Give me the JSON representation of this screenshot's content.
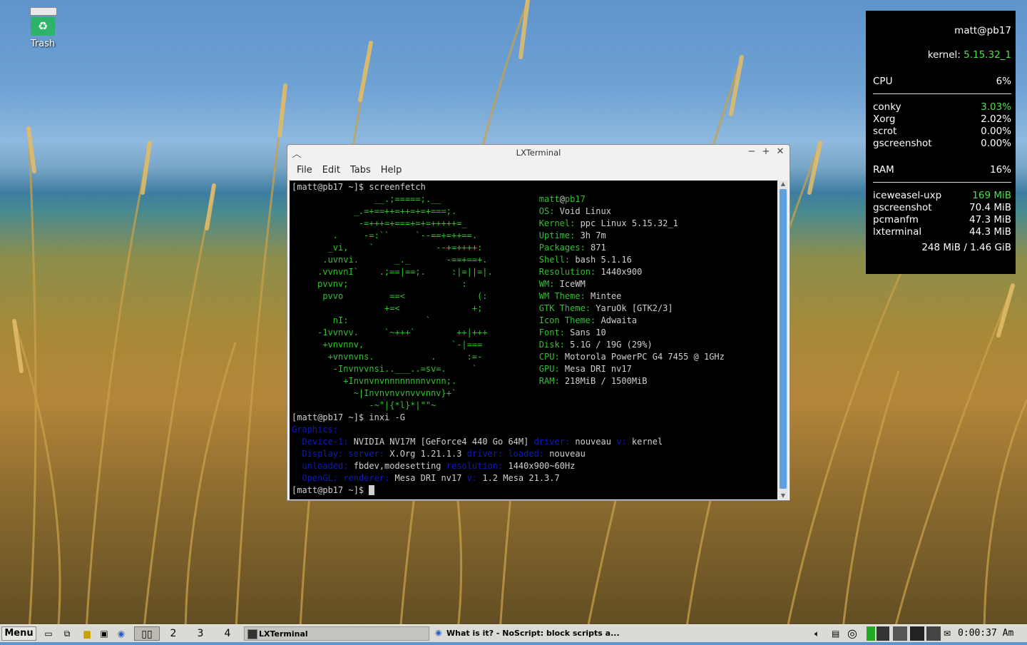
{
  "desktop": {
    "trash_label": "Trash"
  },
  "conky": {
    "user_host": "matt@pb17",
    "kernel_label": "kernel:",
    "kernel_value": "5.15.32_1",
    "cpu_label": "CPU",
    "cpu_value": "6%",
    "cpu_procs": [
      {
        "name": "conky",
        "value": "3.03%"
      },
      {
        "name": "Xorg",
        "value": "2.02%"
      },
      {
        "name": "scrot",
        "value": "0.00%"
      },
      {
        "name": "gscreenshot",
        "value": "0.00%"
      }
    ],
    "ram_label": "RAM",
    "ram_value": "16%",
    "ram_procs": [
      {
        "name": "iceweasel-uxp",
        "value": "169 MiB"
      },
      {
        "name": "gscreenshot",
        "value": "70.4 MiB"
      },
      {
        "name": "pcmanfm",
        "value": "47.3 MiB"
      },
      {
        "name": "lxterminal",
        "value": "44.3 MiB"
      }
    ],
    "ram_total": "248 MiB / 1.46 GiB"
  },
  "window": {
    "title": "LXTerminal",
    "menu": [
      "File",
      "Edit",
      "Tabs",
      "Help"
    ]
  },
  "terminal": {
    "prompt": "[matt@pb17 ~]$ ",
    "cmd1": "screenfetch",
    "art": [
      "                __.;=====;.__",
      "            _.=+==++=++=+=+===;.",
      "             -=+++=+===+=+=+++++=_",
      "        .     -=:``     `--==+=++==.",
      "       _vi,    `            --+=++++:",
      "      .uvnvi.       _._       -==+==+.",
      "     .vvnvnI`    .;==|==;.     :|=||=|.",
      "     pvvnv;                      :",
      "      pvvo         ==<              (:",
      "                  +=<              +;",
      "        nI:               `",
      "     -1vvnvv.     `~+++`        ++|+++",
      "      +vnvnnv,                 `-|===",
      "       +vnvnvns.           .      :=-",
      "        -Invnvvnsi..___..=sv=.     `",
      "          +Invnvnvnnnnnnnnvvnn;.",
      "            ~|Invnvnvvnvvvnnv}+`",
      "               -~\"|{*l}*|\"\"~"
    ],
    "info_user": "matt",
    "info_at": "@",
    "info_host": "pb17",
    "info": [
      {
        "label": "OS:",
        "value": "Void Linux"
      },
      {
        "label": "Kernel:",
        "value": "ppc Linux 5.15.32_1"
      },
      {
        "label": "Uptime:",
        "value": "3h 7m"
      },
      {
        "label": "Packages:",
        "value": "871"
      },
      {
        "label": "Shell:",
        "value": "bash 5.1.16"
      },
      {
        "label": "Resolution:",
        "value": "1440x900"
      },
      {
        "label": "WM:",
        "value": "IceWM"
      },
      {
        "label": "WM Theme:",
        "value": "Mintee"
      },
      {
        "label": "GTK Theme:",
        "value": "YaruOk [GTK2/3]"
      },
      {
        "label": "Icon Theme:",
        "value": "Adwaita"
      },
      {
        "label": "Font:",
        "value": "Sans 10"
      },
      {
        "label": "Disk:",
        "value": "5.1G / 19G (29%)"
      },
      {
        "label": "CPU:",
        "value": "Motorola PowerPC G4 7455 @ 1GHz"
      },
      {
        "label": "GPU:",
        "value": "Mesa DRI nv17"
      },
      {
        "label": "RAM:",
        "value": "218MiB / 1500MiB"
      }
    ],
    "cmd2": "inxi -G",
    "graphics_header": "Graphics:",
    "g_device_label": "Device-1:",
    "g_device_value": "NVIDIA NV17M [GeForce4 440 Go 64M]",
    "g_driver_label": "driver:",
    "g_driver_value": "nouveau",
    "g_v_label": "v:",
    "g_v_value": "kernel",
    "g_display_label": "Display:",
    "g_server_label": "server:",
    "g_server_value": "X.Org 1.21.1.3",
    "g_loaded_label": "driver: loaded:",
    "g_loaded_value": "nouveau",
    "g_unloaded_label": "unloaded:",
    "g_unloaded_value": "fbdev,modesetting",
    "g_res_label": "resolution:",
    "g_res_value": "1440x900~60Hz",
    "g_opengl_label": "OpenGL:",
    "g_renderer_label": "renderer:",
    "g_renderer_value": "Mesa DRI nv17",
    "g_v2_label": "v:",
    "g_v2_value": "1.2 Mesa 21.3.7"
  },
  "taskbar": {
    "menu_label": "Menu",
    "workspaces": [
      "1",
      "2",
      "3",
      "4"
    ],
    "tasks": [
      {
        "label": "LXTerminal"
      },
      {
        "label": "What is it? - NoScript: block scripts a..."
      }
    ],
    "clock": "0:00:37 Am"
  }
}
